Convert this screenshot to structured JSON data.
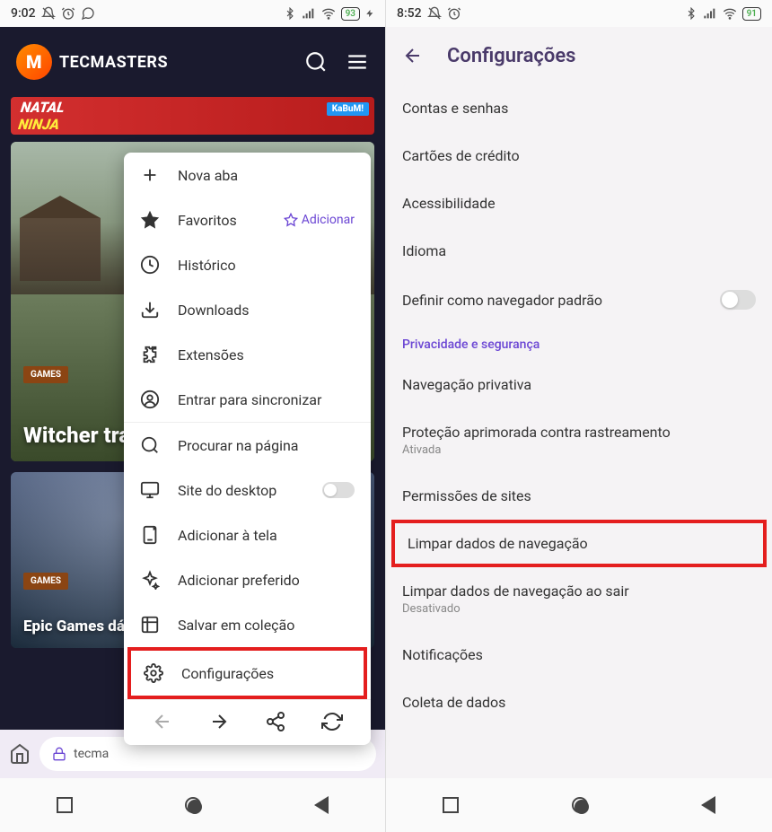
{
  "left": {
    "status": {
      "time": "9:02",
      "battery": "93"
    },
    "site": {
      "logo_text": "TECMASTERS",
      "banner_main": "NATAL",
      "banner_sub": "NINJA",
      "banner_tag": "KaBuM!"
    },
    "articles": {
      "a1": {
        "tag": "GAMES",
        "title": "Witcher  tracing  série da "
      },
      "a2": {
        "tag": "GAMES",
        "title": "Epic Games dá T Vanishing of Eth "
      }
    },
    "url_text": "tecma",
    "menu": {
      "new_tab": "Nova aba",
      "favorites": "Favoritos",
      "favorites_add": "Adicionar",
      "history": "Histórico",
      "downloads": "Downloads",
      "extensions": "Extensões",
      "sync": "Entrar para sincronizar",
      "find": "Procurar na página",
      "desktop": "Site do desktop",
      "add_screen": "Adicionar à tela",
      "add_pref": "Adicionar preferido",
      "save_col": "Salvar em coleção",
      "settings": "Configurações"
    }
  },
  "right": {
    "status": {
      "time": "8:52",
      "battery": "91"
    },
    "title": "Configurações",
    "items": {
      "accounts": "Contas e senhas",
      "cards": "Cartões de crédito",
      "accessibility": "Acessibilidade",
      "language": "Idioma",
      "default_browser": "Definir como navegador padrão",
      "section_privacy": "Privacidade e segurança",
      "private_nav": "Navegação privativa",
      "tracking": "Proteção aprimorada contra rastreamento",
      "tracking_sub": "Ativada",
      "permissions": "Permissões de sites",
      "clear_data": "Limpar dados de navegação",
      "clear_on_exit": "Limpar dados de navegação ao sair",
      "clear_on_exit_sub": "Desativado",
      "notifications": "Notificações",
      "data_collect": "Coleta de dados"
    }
  }
}
